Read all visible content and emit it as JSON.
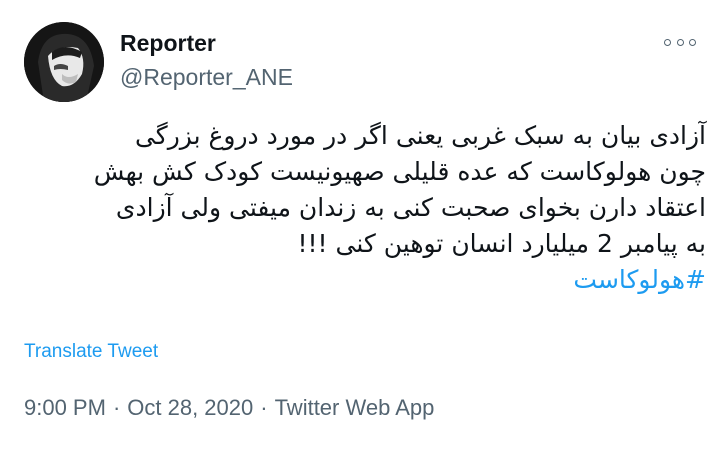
{
  "author": {
    "display_name": "Reporter",
    "handle": "@Reporter_ANE",
    "avatar_icon": "profile-photo-masked-face"
  },
  "more_icon": "more-options-icon",
  "tweet": {
    "lines": [
      "آزادی بیان به سبک غربی یعنی اگر در مورد دروغ بزرگی",
      "چون هولوکاست که عده قلیلی صهیونیست کودک کش بهش",
      "اعتقاد دارن بخوای صحبت کنی به زندان میفتی ولی آزادی",
      "به پیامبر 2 میلیارد انسان توهین کنی !!!"
    ],
    "hashtag": "#هولوکاست"
  },
  "translate_label": "Translate Tweet",
  "meta": {
    "time": "9:00 PM",
    "date": "Oct 28, 2020",
    "source": "Twitter Web App",
    "separator": "·"
  },
  "colors": {
    "text": "#0f1419",
    "secondary": "#536471",
    "link": "#1d9bf0"
  }
}
